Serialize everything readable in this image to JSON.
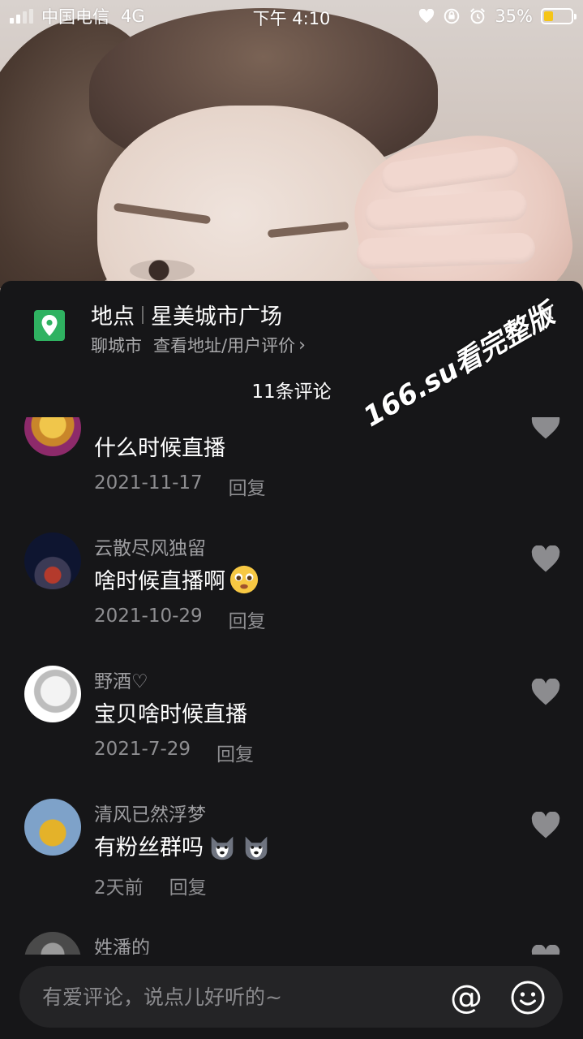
{
  "status_bar": {
    "carrier": "中国电信",
    "network": "4G",
    "time": "下午 4:10",
    "battery": "35%",
    "battery_level": 0.35,
    "battery_color": "#f5c518"
  },
  "location_panel": {
    "label": "地点",
    "name": "星美城市广场",
    "city": "聊城市",
    "link": "查看地址/用户评价",
    "link_chevron": "›",
    "icon": "map-pin-icon",
    "icon_color": "#2fb261",
    "close_icon": "close-icon"
  },
  "comment_count": "11条评论",
  "comments": [
    {
      "username": "",
      "text": "什么时候直播",
      "date": "2021-11-17",
      "reply": "回复",
      "avatar": "lion-avatar"
    },
    {
      "username": "云散尽风独留",
      "text": "啥时候直播啊",
      "date": "2021-10-29",
      "reply": "回复",
      "avatar": "night-crowd-avatar",
      "emoji": "pleading-face-emoji"
    },
    {
      "username": "野酒♡",
      "text": "宝贝啥时候直播",
      "date": "2021-7-29",
      "reply": "回复",
      "avatar": "anime-avatar"
    },
    {
      "username": "清风已然浮梦",
      "text": "有粉丝群吗",
      "date": "2天前",
      "reply": "回复",
      "avatar": "yellow-coat-avatar",
      "emoji": "husky-emoji"
    },
    {
      "username": "姓潘的",
      "text": "",
      "date": "",
      "reply": "",
      "avatar": "partial-avatar"
    }
  ],
  "watermark": "166.su看完整版",
  "input": {
    "placeholder": "有爱评论，说点儿好听的~",
    "at_label": "@",
    "emoji_icon": "smiley-icon"
  }
}
